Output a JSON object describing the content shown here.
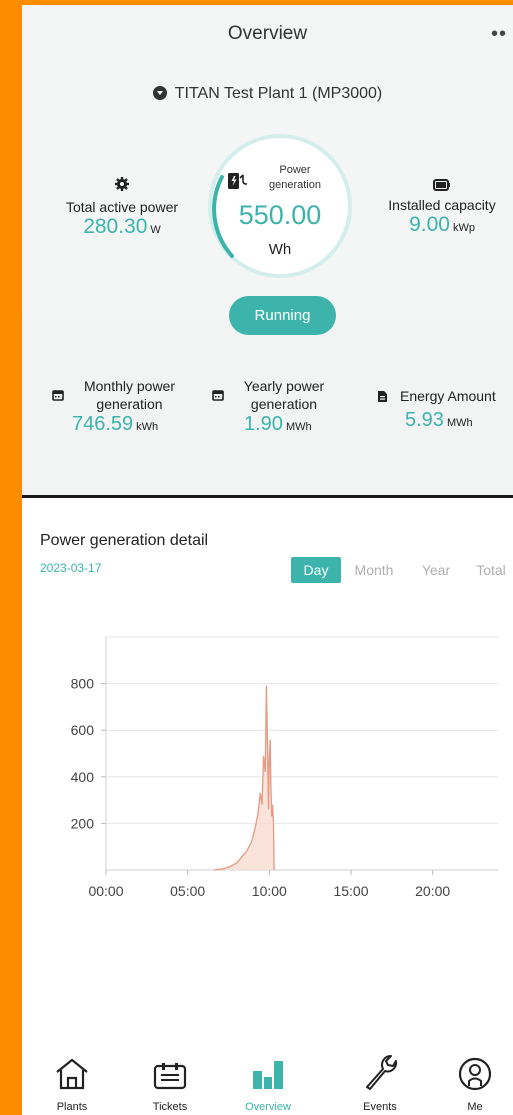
{
  "header": {
    "title": "Overview",
    "more_icon": "more-dots-icon"
  },
  "plant": {
    "name": "TITAN Test Plant 1 (MP3000)"
  },
  "ring": {
    "label": "Power generation",
    "value": "550.00",
    "unit": "Wh"
  },
  "stats": {
    "total_active_power": {
      "label": "Total active power",
      "value": "280.30",
      "unit": "W"
    },
    "installed_capacity": {
      "label": "Installed capacity",
      "value": "9.00",
      "unit": "kWp"
    }
  },
  "status": {
    "label": "Running"
  },
  "metrics": {
    "monthly": {
      "label": "Monthly power generation",
      "value": "746.59",
      "unit": "kWh"
    },
    "yearly": {
      "label": "Yearly power generation",
      "value": "1.90",
      "unit": "MWh"
    },
    "energy": {
      "label": "Energy Amount",
      "value": "5.93",
      "unit": "MWh"
    }
  },
  "detail": {
    "title": "Power generation detail",
    "date": "2023-03-17",
    "tabs": [
      "Day",
      "Month",
      "Year",
      "Total"
    ],
    "active_tab": "Day"
  },
  "chart_data": {
    "type": "area",
    "x_ticks": [
      "00:00",
      "05:00",
      "10:00",
      "15:00",
      "20:00"
    ],
    "y_ticks": [
      "200",
      "400",
      "600",
      "800"
    ],
    "x_hours": [
      6.6,
      7.2,
      7.6,
      8.0,
      8.3,
      8.6,
      8.9,
      9.1,
      9.3,
      9.45,
      9.55,
      9.65,
      9.75,
      9.82,
      9.9,
      9.95,
      10.0,
      10.05,
      10.1,
      10.15,
      10.2,
      10.25,
      10.3
    ],
    "y_values": [
      0,
      5,
      15,
      30,
      55,
      80,
      120,
      170,
      240,
      330,
      280,
      490,
      420,
      790,
      500,
      260,
      480,
      560,
      340,
      230,
      280,
      210,
      0
    ],
    "xlim": [
      0,
      24
    ],
    "ylim": [
      0,
      1000
    ],
    "color": "#e59a82",
    "fill": "#f8dcd2"
  },
  "nav": {
    "items": [
      {
        "label": "Plants",
        "icon": "home-icon"
      },
      {
        "label": "Tickets",
        "icon": "ticket-icon"
      },
      {
        "label": "Overview",
        "icon": "overview-chart-icon"
      },
      {
        "label": "Events",
        "icon": "wrench-icon"
      },
      {
        "label": "Me",
        "icon": "profile-icon"
      }
    ],
    "active": "Overview"
  },
  "colors": {
    "accent": "#3cb4ac",
    "border": "#ff8c00"
  }
}
